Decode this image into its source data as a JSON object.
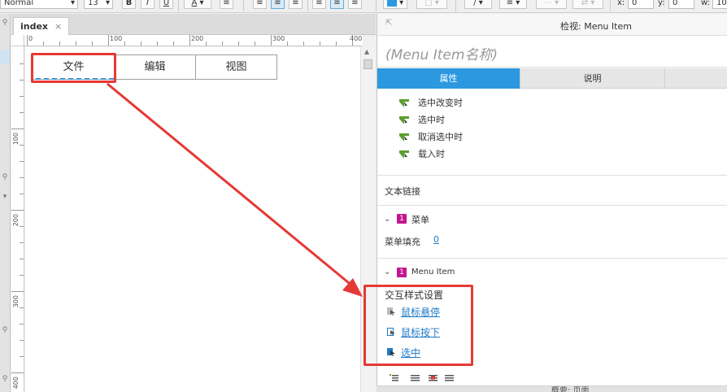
{
  "toolbar": {
    "style_select": "Normal",
    "font_size": "13",
    "bold": "B",
    "italic": "I",
    "underline": "U",
    "font_color": "A",
    "x_label": "x:",
    "x_value": "0",
    "y_label": "y:",
    "y_value": "0",
    "w_label": "w:",
    "w_value": "10",
    "fill_color": "#2b98e0"
  },
  "editor": {
    "tab_label": "index",
    "tab_close": "×",
    "ruler_h": [
      "0",
      "100",
      "200",
      "300",
      "400"
    ],
    "ruler_v": [
      "100",
      "200",
      "300",
      "400"
    ]
  },
  "menu_widget": {
    "items": [
      "文件",
      "编辑",
      "视图"
    ]
  },
  "inspector": {
    "title": "检视: Menu Item",
    "name_placeholder": "(Menu Item名称)",
    "tabs": [
      "属性",
      "说明"
    ],
    "events": [
      "选中改变时",
      "选中时",
      "取消选中时",
      "载入时"
    ],
    "text_link": "文本链接",
    "menu_section": {
      "badge": "1",
      "label": "菜单",
      "fill_label": "菜单填充",
      "fill_value": "0"
    },
    "menu_item_section": {
      "badge": "1",
      "label": "Menu Item",
      "interaction_title": "交互样式设置",
      "links": [
        "鼠标悬停",
        "鼠标按下",
        "选中"
      ]
    },
    "bottom_panel": "概要: 页面"
  },
  "colors": {
    "accent": "#2b98e0",
    "highlight": "#e53935",
    "badge": "#c2188f",
    "event_icon": "#5aa02c"
  }
}
